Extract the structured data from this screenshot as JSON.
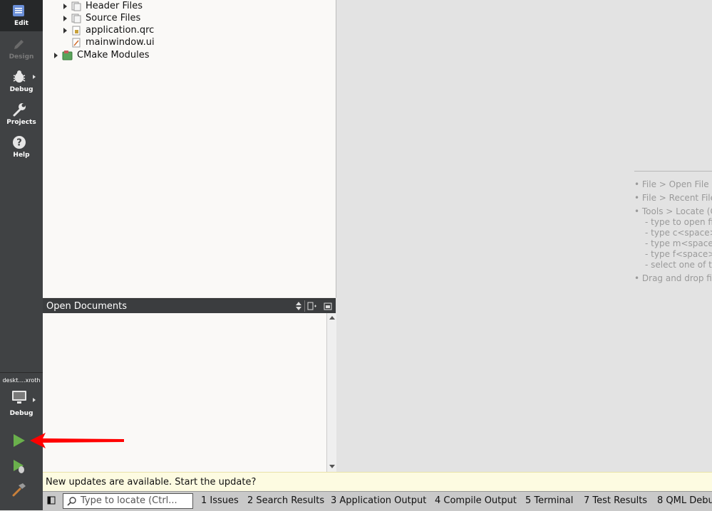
{
  "modes": [
    {
      "label": "Edit",
      "icon": "edit-icon"
    },
    {
      "label": "Design",
      "icon": "design-pencil-icon"
    },
    {
      "label": "Debug",
      "icon": "bug-icon"
    },
    {
      "label": "Projects",
      "icon": "wrench-icon"
    },
    {
      "label": "Help",
      "icon": "help-icon"
    }
  ],
  "kit": {
    "name": "deskt....xroth",
    "build_label": "Debug"
  },
  "tree": {
    "items": [
      "Header Files",
      "Source Files",
      "application.qrc",
      "mainwindow.ui",
      "CMake Modules"
    ]
  },
  "open_documents": {
    "title": "Open Documents"
  },
  "editor_hints": [
    "• File > Open File or",
    "• File > Recent Files",
    "• Tools > Locate (Ct",
    "- type to open fil",
    "- type c<space>",
    "- type m<space>",
    "- type f<space>",
    "- select one of th",
    "• Drag and drop file"
  ],
  "update_bar": {
    "message": "New updates are available. Start the update?"
  },
  "bottom": {
    "locator_placeholder": "Type to locate (Ctrl...",
    "panes": [
      "1  Issues",
      "2  Search Results",
      "3  Application Output",
      "4  Compile Output",
      "5  Terminal",
      "7  Test Results",
      "8  QML Debu"
    ]
  },
  "colors": {
    "sidebar": "#404244",
    "run_green": "#6ab04c",
    "update_bg": "#fdfbe1",
    "annotation_red": "#ff0000"
  }
}
